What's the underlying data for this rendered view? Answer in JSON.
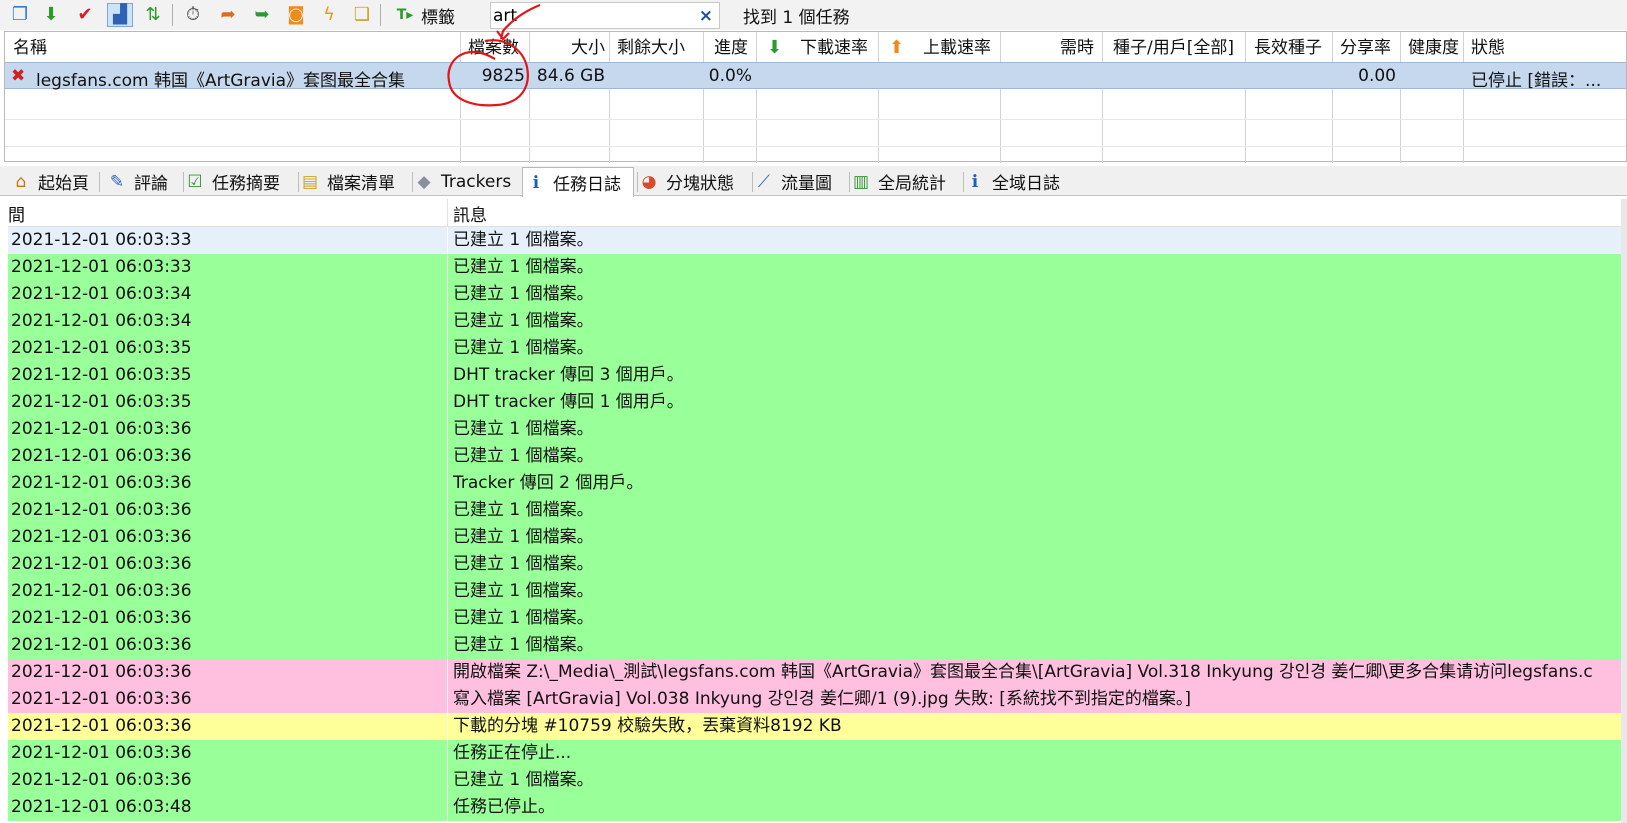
{
  "toolbar": {
    "buttons": [
      {
        "name": "new-task-icon",
        "glyph": "❐",
        "color": "#3a78c8"
      },
      {
        "name": "download-icon",
        "glyph": "⬇",
        "color": "#2e9a2e"
      },
      {
        "name": "check-icon",
        "glyph": "✔",
        "color": "#d22020"
      },
      {
        "name": "layout-icon",
        "glyph": "▟",
        "color": "#2c63b8"
      },
      {
        "name": "sort-arrows-icon",
        "glyph": "⇅",
        "color": "#2e9a2e"
      },
      {
        "name": "timer-icon",
        "glyph": "⏱",
        "color": "#555555"
      },
      {
        "name": "import-icon",
        "glyph": "➦",
        "color": "#e06a1a"
      },
      {
        "name": "export-icon",
        "glyph": "➥",
        "color": "#2e9a2e"
      },
      {
        "name": "rss-icon",
        "glyph": "◙",
        "color": "#f08a18"
      },
      {
        "name": "lightning-icon",
        "glyph": "ϟ",
        "color": "#e0a010"
      },
      {
        "name": "clipboard-icon",
        "glyph": "❏",
        "color": "#c9a227"
      }
    ],
    "tag_label": "標籤",
    "search_value": "art",
    "search_clear": "×",
    "found_text": "找到 1 個任務"
  },
  "torrent_list": {
    "columns": [
      "名稱",
      "檔案數",
      "大小",
      "剩餘大小",
      "進度",
      "下載速率",
      "上載速率",
      "需時",
      "種子/用戶[全部]",
      "長效種子",
      "分享率",
      "健康度",
      "狀態"
    ],
    "rows": [
      {
        "status_icon": "✖",
        "name": "legsfans.com  韩国《ArtGravia》套图最全合集",
        "files": "9825",
        "size": "84.6 GB",
        "remaining": "",
        "progress": "0.0%",
        "down_rate": "",
        "up_rate": "",
        "eta": "",
        "seeds_peers": "",
        "seeds_long": "",
        "ratio": "0.00",
        "health": "",
        "status": "已停止 [錯誤：..."
      }
    ]
  },
  "tabs": [
    {
      "label": "起始頁",
      "icon": "home-page-icon",
      "glyph": "⌂",
      "color": "#c07a18"
    },
    {
      "label": "評論",
      "icon": "comments-icon",
      "glyph": "✎",
      "color": "#2c63b8"
    },
    {
      "label": "任務摘要",
      "icon": "summary-icon",
      "glyph": "☑",
      "color": "#2e9a2e"
    },
    {
      "label": "檔案清單",
      "icon": "file-list-icon",
      "glyph": "▤",
      "color": "#c9a227"
    },
    {
      "label": "Trackers",
      "icon": "trackers-icon",
      "glyph": "◆",
      "color": "#8a8fa0"
    },
    {
      "label": "任務日誌",
      "icon": "info-icon",
      "glyph": "ℹ",
      "color": "#1a5fb8",
      "active": true
    },
    {
      "label": "分塊狀態",
      "icon": "pie-chart-icon",
      "glyph": "◕",
      "color": "#d84a2a"
    },
    {
      "label": "流量圖",
      "icon": "line-graph-icon",
      "glyph": "⟋",
      "color": "#2c63b8"
    },
    {
      "label": "全局統計",
      "icon": "stats-icon",
      "glyph": "▥",
      "color": "#2e9a2e"
    },
    {
      "label": "全域日誌",
      "icon": "global-info-icon",
      "glyph": "ℹ",
      "color": "#1a5fb8"
    }
  ],
  "log": {
    "columns": [
      "間",
      "訊息"
    ],
    "row_colors": {
      "selected": "#e6f0fb",
      "info": "#99ff99",
      "error": "#ffbfdf",
      "warning": "#ffff99"
    },
    "rows": [
      {
        "time": "2021-12-01 06:03:33",
        "message": "已建立 1 個檔案。",
        "level": "selected"
      },
      {
        "time": "2021-12-01 06:03:33",
        "message": "已建立 1 個檔案。",
        "level": "info"
      },
      {
        "time": "2021-12-01 06:03:34",
        "message": "已建立 1 個檔案。",
        "level": "info"
      },
      {
        "time": "2021-12-01 06:03:34",
        "message": "已建立 1 個檔案。",
        "level": "info"
      },
      {
        "time": "2021-12-01 06:03:35",
        "message": "已建立 1 個檔案。",
        "level": "info"
      },
      {
        "time": "2021-12-01 06:03:35",
        "message": "DHT tracker 傳回 3 個用戶。",
        "level": "info"
      },
      {
        "time": "2021-12-01 06:03:35",
        "message": "DHT tracker 傳回 1 個用戶。",
        "level": "info"
      },
      {
        "time": "2021-12-01 06:03:36",
        "message": "已建立 1 個檔案。",
        "level": "info"
      },
      {
        "time": "2021-12-01 06:03:36",
        "message": "已建立 1 個檔案。",
        "level": "info"
      },
      {
        "time": "2021-12-01 06:03:36",
        "message": "Tracker 傳回 2 個用戶。",
        "level": "info"
      },
      {
        "time": "2021-12-01 06:03:36",
        "message": "已建立 1 個檔案。",
        "level": "info"
      },
      {
        "time": "2021-12-01 06:03:36",
        "message": "已建立 1 個檔案。",
        "level": "info"
      },
      {
        "time": "2021-12-01 06:03:36",
        "message": "已建立 1 個檔案。",
        "level": "info"
      },
      {
        "time": "2021-12-01 06:03:36",
        "message": "已建立 1 個檔案。",
        "level": "info"
      },
      {
        "time": "2021-12-01 06:03:36",
        "message": "已建立 1 個檔案。",
        "level": "info"
      },
      {
        "time": "2021-12-01 06:03:36",
        "message": "已建立 1 個檔案。",
        "level": "info"
      },
      {
        "time": "2021-12-01 06:03:36",
        "message": "開啟檔案 Z:\\_Media\\_測試\\legsfans.com  韩国《ArtGravia》套图最全合集\\[ArtGravia] Vol.318 Inkyung 강인경 姜仁卿\\更多合集请访问legsfans.c",
        "level": "error"
      },
      {
        "time": "2021-12-01 06:03:36",
        "message": "寫入檔案 [ArtGravia] Vol.038 Inkyung 강인경 姜仁卿/1 (9).jpg 失敗: [系統找不到指定的檔案。]",
        "level": "error"
      },
      {
        "time": "2021-12-01 06:03:36",
        "message": "下載的分塊 #10759 校驗失敗，丟棄資料8192 KB",
        "level": "warning"
      },
      {
        "time": "2021-12-01 06:03:36",
        "message": "任務正在停止...",
        "level": "info"
      },
      {
        "time": "2021-12-01 06:03:36",
        "message": "已建立 1 個檔案。",
        "level": "info"
      },
      {
        "time": "2021-12-01 06:03:48",
        "message": "任務已停止。",
        "level": "info"
      }
    ]
  }
}
